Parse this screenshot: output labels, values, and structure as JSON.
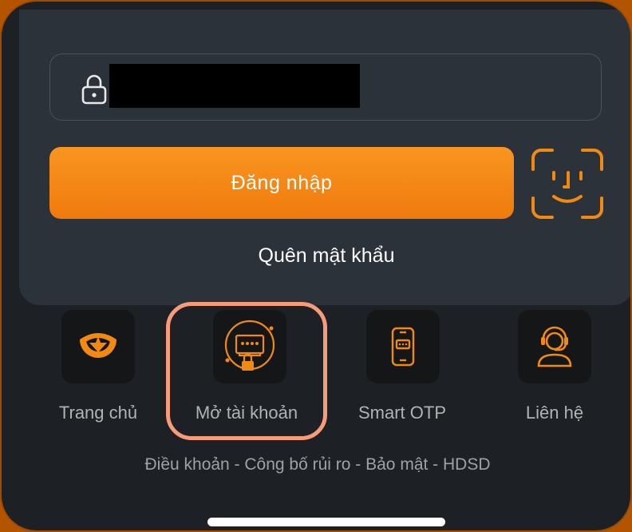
{
  "login": {
    "password_placeholder": "",
    "login_button_label": "Đăng nhập",
    "forgot_password_label": "Quên mật khẩu"
  },
  "menu": {
    "items": [
      {
        "label": "Trang chủ",
        "icon": "home-logo-icon"
      },
      {
        "label": "Mở tài khoản",
        "icon": "open-account-icon"
      },
      {
        "label": "Smart OTP",
        "icon": "smartphone-otp-icon"
      },
      {
        "label": "Liên hệ",
        "icon": "headset-support-icon"
      }
    ]
  },
  "footer": {
    "links_text": "Điều khoản - Công bố rủi ro - Bảo mật - HDSD"
  },
  "colors": {
    "accent": "#f28a12",
    "highlight": "#f89b78",
    "background": "#1d2024",
    "card": "#2b3239"
  }
}
